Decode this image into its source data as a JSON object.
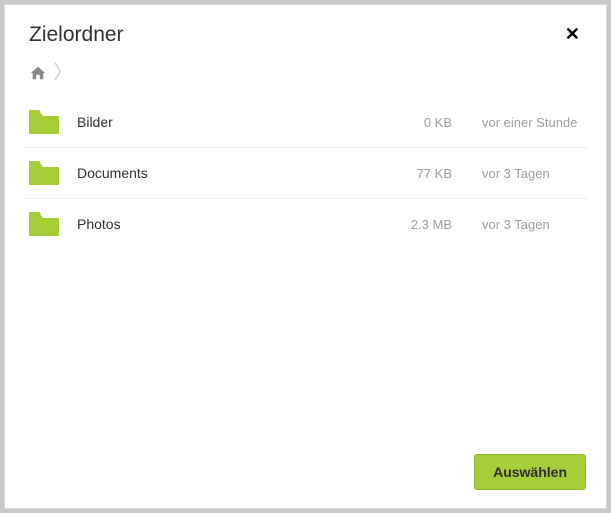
{
  "dialog": {
    "title": "Zielordner",
    "select_label": "Auswählen"
  },
  "folders": [
    {
      "name": "Bilder",
      "size": "0 KB",
      "time": "vor einer Stunde"
    },
    {
      "name": "Documents",
      "size": "77 KB",
      "time": "vor 3 Tagen"
    },
    {
      "name": "Photos",
      "size": "2.3 MB",
      "time": "vor 3 Tagen"
    }
  ],
  "colors": {
    "accent": "#a6ce39"
  }
}
